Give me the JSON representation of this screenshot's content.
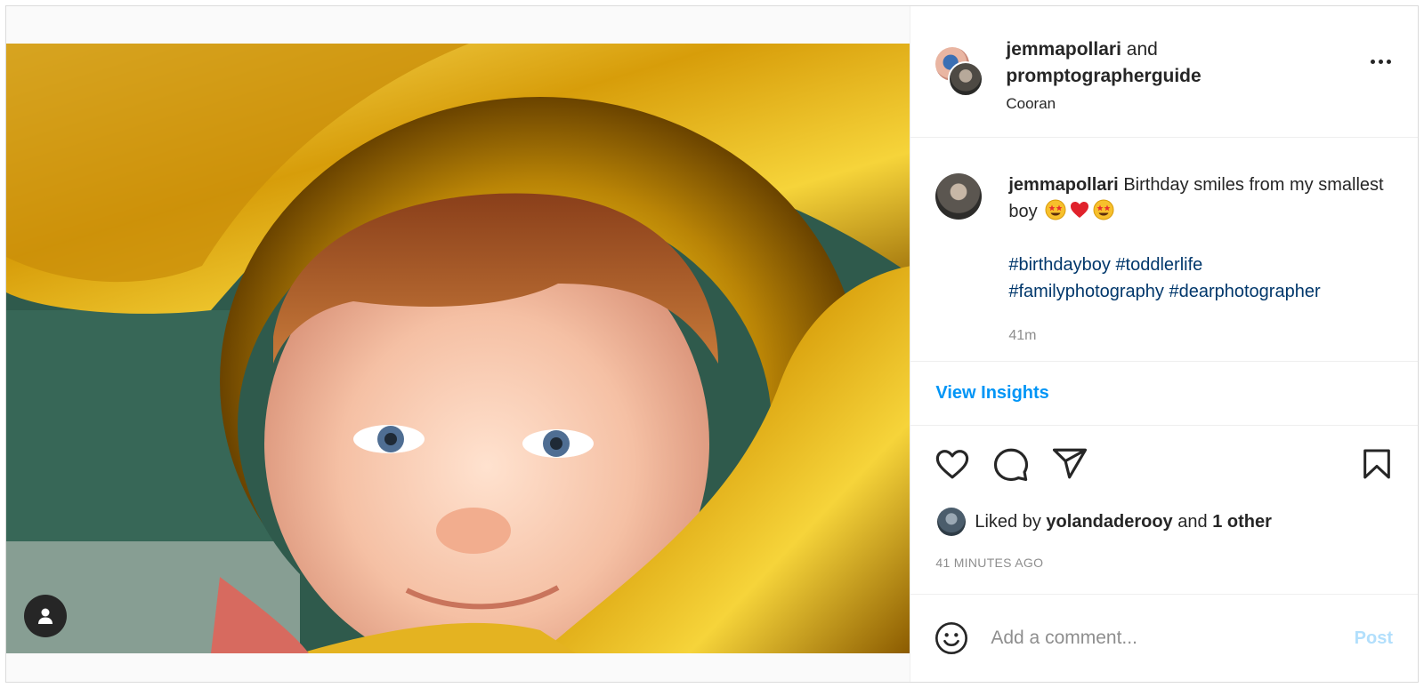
{
  "post": {
    "media_alt": "Photo of a toddler framed by a gold balloon"
  },
  "header": {
    "user1": "jemmapollari",
    "connector": "and",
    "user2": "promptographerguide",
    "location": "Cooran"
  },
  "caption": {
    "username": "jemmapollari",
    "text": "Birthday smiles from my smallest boy",
    "hashtags_line1": "#birthdayboy #toddlerlife",
    "hashtags_line2": "#familyphotography #dearphotographer",
    "time": "41m",
    "emojis": [
      "star-struck-emoji",
      "red-heart-emoji",
      "star-struck-emoji"
    ]
  },
  "insights": {
    "label": "View Insights"
  },
  "likes": {
    "prefix": "Liked by",
    "user": "yolandaderooy",
    "and": "and",
    "others": "1 other",
    "time_ago": "41 MINUTES AGO"
  },
  "comment": {
    "placeholder": "Add a comment...",
    "post_label": "Post"
  },
  "icons": {
    "like": "heart-icon",
    "comment": "comment-icon",
    "share": "share-icon",
    "save": "bookmark-icon",
    "emoji": "smiley-icon",
    "more": "more-icon",
    "tag": "user-tag-icon"
  },
  "colors": {
    "link": "#0095f6",
    "post_disabled": "#b2dffc",
    "secondary_text": "#8e8e8e",
    "hashtag": "#00376b"
  }
}
